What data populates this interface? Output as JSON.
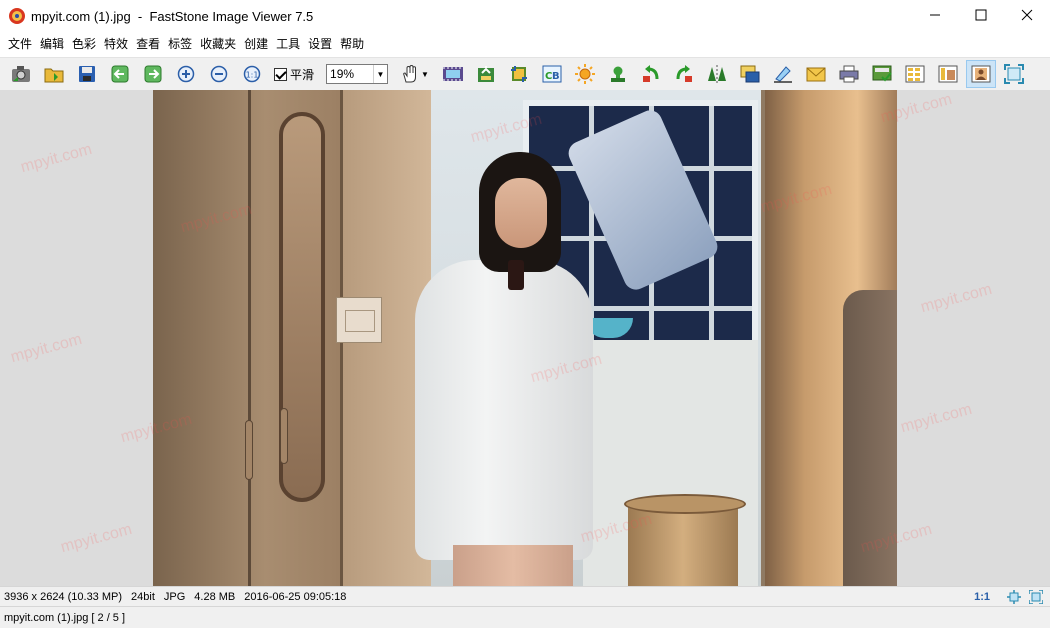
{
  "window": {
    "title": "mpyit.com (1).jpg  -  FastStone Image Viewer 7.5",
    "controls": {
      "minimize": "—",
      "maximize": "☐",
      "close": "✕"
    }
  },
  "menu": {
    "items": [
      "文件",
      "编辑",
      "色彩",
      "特效",
      "查看",
      "标签",
      "收藏夹",
      "创建",
      "工具",
      "设置",
      "帮助"
    ]
  },
  "toolbar": {
    "smooth_label": "平滑",
    "smooth_checked": true,
    "zoom_value": "19%",
    "buttons_left": [
      "camera-open-icon",
      "folder-open-icon",
      "save-icon",
      "previous-icon",
      "next-icon",
      "zoom-in-icon",
      "zoom-out-icon",
      "actual-size-icon"
    ],
    "buttons_right": [
      "slideshow-icon",
      "compare-icon",
      "crop-icon",
      "color-balance-icon",
      "brightness-icon",
      "stamp-icon",
      "rotate-left-icon",
      "rotate-right-icon",
      "flip-icon",
      "resize-icon",
      "draw-icon",
      "email-icon",
      "print-icon",
      "wallpaper-icon",
      "browser-layout-icon",
      "thumbnail-layout-icon",
      "viewer-layout-icon",
      "fullscreen-icon"
    ]
  },
  "image": {
    "watermark": "mpyit.com",
    "description": "photograph of girl in white shirt in bathroom"
  },
  "status": {
    "dimensions": "3936 x 2624 (10.33 MP)",
    "bit_depth": "24bit",
    "format": "JPG",
    "file_size": "4.28 MB",
    "datetime": "2016-06-25 09:05:18",
    "ratio": "1:1"
  },
  "file_info": {
    "text": "mpyit.com (1).jpg [ 2 / 5 ]"
  }
}
